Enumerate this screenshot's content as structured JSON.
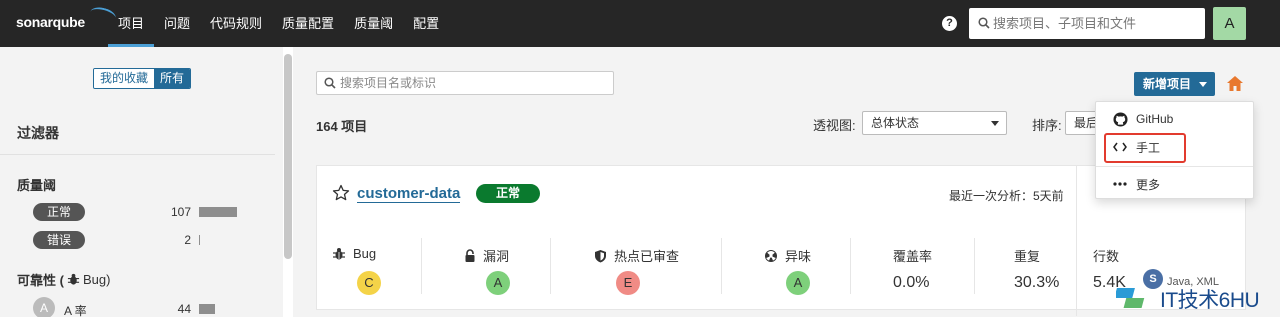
{
  "header": {
    "logo": "sonarqube",
    "nav": [
      "项目",
      "问题",
      "代码规则",
      "质量配置",
      "质量阈",
      "配置"
    ],
    "search_placeholder": "搜索项目、子项目和文件",
    "avatar": "A"
  },
  "sidebar": {
    "toggle": [
      "我的收藏",
      "所有"
    ],
    "filter_title": "过滤器",
    "quality_gate_title": "质量阈",
    "gates": [
      {
        "label": "正常",
        "count": "107",
        "fraction": 0.97
      },
      {
        "label": "错误",
        "count": "2",
        "fraction": 0.02
      }
    ],
    "reliability_title": "可靠性 (",
    "reliability_sub": "Bug)",
    "reliability_rows": [
      {
        "rating": "A",
        "label": "A 率",
        "count": "44",
        "fraction": 0.4
      }
    ]
  },
  "main": {
    "search_placeholder": "搜索项目名或标识",
    "project_count": "164 项目",
    "perspective_label": "透视图:",
    "perspective_value": "总体状态",
    "sort_label": "排序:",
    "sort_value": "最后",
    "new_project_label": "新增项目"
  },
  "dropdown": {
    "items": [
      "GitHub",
      "手工",
      "更多"
    ]
  },
  "project": {
    "name": "customer-data",
    "status": "正常",
    "analysis": "最近一次分析：5天前",
    "metrics": [
      {
        "label": "Bug",
        "icon": "bug-icon",
        "rating": "C",
        "color": "#f4d348"
      },
      {
        "label": "漏洞",
        "icon": "lock-icon",
        "rating": "A",
        "color": "#7ed07b"
      },
      {
        "label": "热点已审查",
        "icon": "shield-icon",
        "rating": "E",
        "color": "#f08b85"
      },
      {
        "label": "异味",
        "icon": "radioactive-icon",
        "rating": "A",
        "color": "#7ed07b"
      },
      {
        "label": "覆盖率",
        "value": "0.0%"
      },
      {
        "label": "重复",
        "value": "30.3%"
      },
      {
        "label": "行数",
        "value": "5.4K",
        "languages": "Java, XML"
      }
    ],
    "lang_avatar": "S"
  },
  "watermark": "IT技术6HU"
}
